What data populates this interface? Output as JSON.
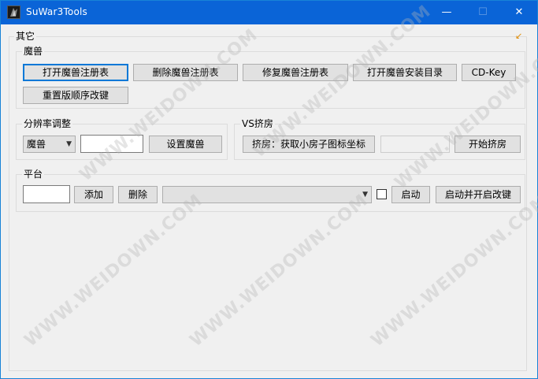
{
  "window": {
    "title": "SuWar3Tools",
    "minimize_label": "—",
    "maximize_label": "☐",
    "close_label": "✕"
  },
  "groups": {
    "other": "其它",
    "warcraft": "魔兽",
    "resolution": "分辨率调整",
    "vs": "VS挤房",
    "platform": "平台"
  },
  "warcraft_buttons": {
    "open_registry": "打开魔兽注册表",
    "delete_registry": "删除魔兽注册表",
    "repair_registry": "修复魔兽注册表",
    "open_install_dir": "打开魔兽安装目录",
    "cd_key": "CD-Key",
    "reset_keys": "重置版顺序改键"
  },
  "resolution": {
    "combo_value": "魔兽",
    "input_value": "",
    "set_button": "设置魔兽"
  },
  "vs": {
    "get_coords_button": "挤房：获取小房子图标坐标",
    "coords_value": "",
    "start_button": "开始挤房"
  },
  "platform": {
    "input_value": "",
    "add_button": "添加",
    "delete_button": "删除",
    "combo_value": "",
    "start_button": "启动",
    "start_with_keys_button": "启动并开启改键"
  },
  "watermark_text": "WWW.WEIDOWN.COM",
  "icons": {
    "resize": "resize-arrow-icon",
    "app": "app-icon",
    "dropdown": "chevron-down-icon"
  },
  "colors": {
    "titlebar": "#0a64d7",
    "focus": "#0078d7"
  }
}
